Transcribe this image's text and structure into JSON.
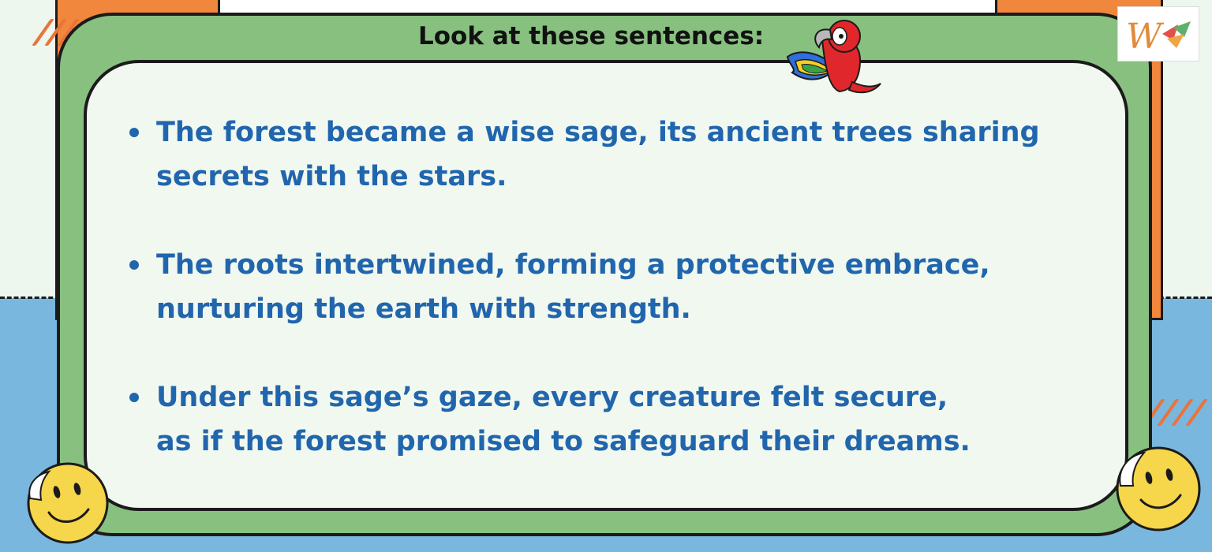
{
  "heading": "Look at these sentences:",
  "sentences": [
    "The forest became a wise sage, its ancient trees sharing\nsecrets with the stars.",
    "The roots intertwined, forming a protective embrace,\nnurturing the earth with strength.",
    "Under this sage’s gaze, every creature felt secure,\nas if the forest promised to safeguard their dreams."
  ],
  "colors": {
    "sentence_text": "#2166ad",
    "frame_green": "#88c080",
    "card_bg": "#f1f8f0",
    "orange_accent": "#f0873d",
    "sky_blue": "#7ab7de"
  },
  "icons": [
    "parrot-icon",
    "smiley-icon",
    "logo-icon",
    "slash-marks"
  ]
}
